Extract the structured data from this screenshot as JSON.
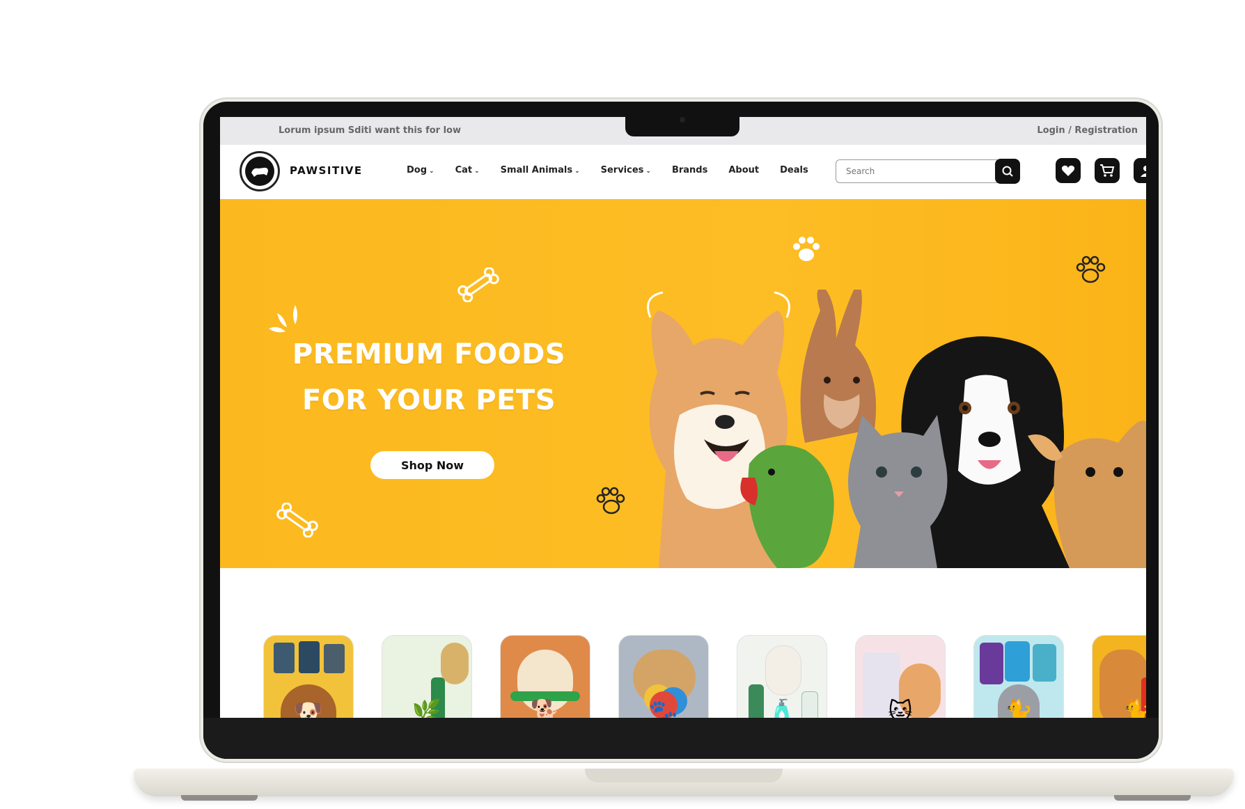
{
  "topbar": {
    "tagline": "Lorum ipsum Sditi want this for low",
    "auth_link": "Login / Registration"
  },
  "header": {
    "brand": "PAWSITIVE",
    "nav": [
      {
        "label": "Dog",
        "dropdown": true
      },
      {
        "label": "Cat",
        "dropdown": true
      },
      {
        "label": "Small Animals",
        "dropdown": true
      },
      {
        "label": "Services",
        "dropdown": true
      },
      {
        "label": "Brands",
        "dropdown": false
      },
      {
        "label": "About",
        "dropdown": false
      },
      {
        "label": "Deals",
        "dropdown": false
      }
    ],
    "search_placeholder": "Search",
    "icons": [
      "search-icon",
      "heart-icon",
      "cart-icon",
      "user-icon"
    ]
  },
  "hero": {
    "headline_line1": "PREMIUM FOODS",
    "headline_line2": "FOR YOUR PETS",
    "cta_label": "Shop Now",
    "bg_color": "#fdbd24"
  },
  "categories": [
    {
      "name": "dog-treats",
      "bg": "#f2c23a",
      "icon": "🐶"
    },
    {
      "name": "tick-protection",
      "bg": "#eaf2e2",
      "icon": "🌿"
    },
    {
      "name": "dog-toys-rope",
      "bg": "#e08a4a",
      "icon": "🐕"
    },
    {
      "name": "puppy-toys",
      "bg": "#aeb8c4",
      "icon": "🐾"
    },
    {
      "name": "grooming",
      "bg": "#f0f3ee",
      "icon": "🧴"
    },
    {
      "name": "cat-food",
      "bg": "#f6e2e6",
      "icon": "🐱"
    },
    {
      "name": "cat-treats",
      "bg": "#bfe8ee",
      "icon": "🐈"
    },
    {
      "name": "cat-dry-food",
      "bg": "#f3b420",
      "icon": "🐈"
    }
  ],
  "colors": {
    "accent": "#fdbd24",
    "dark": "#111111"
  }
}
